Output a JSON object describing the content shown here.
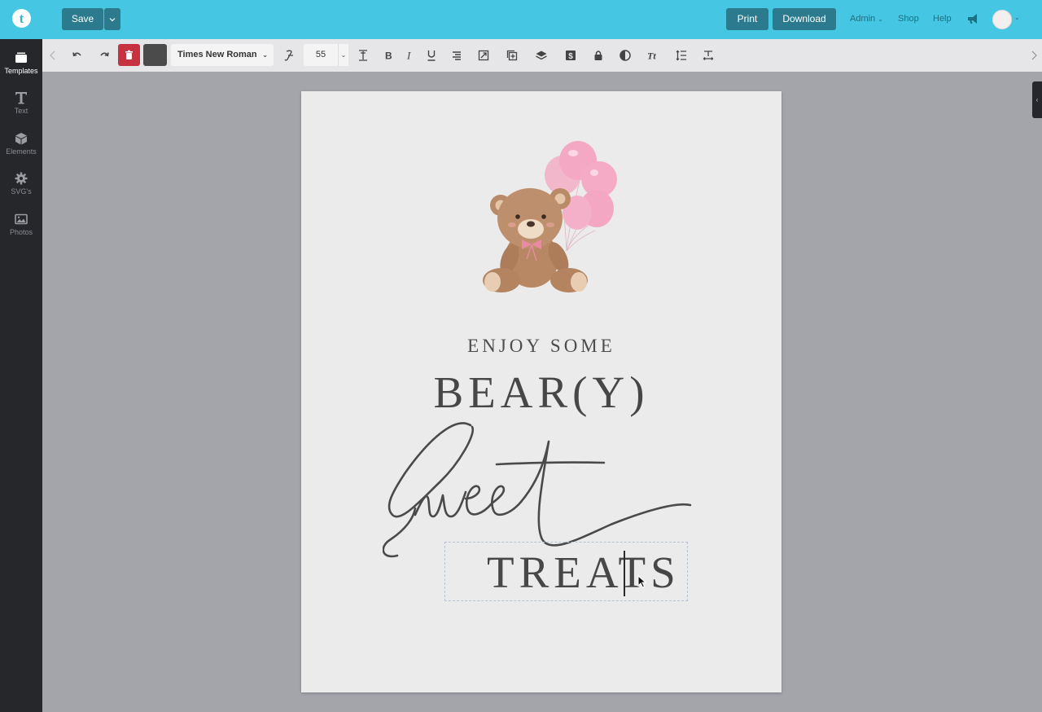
{
  "app": {
    "logo_letter": "t",
    "accent_color": "#45c6e3",
    "button_color": "#2c7a8d"
  },
  "header": {
    "save_label": "Save",
    "print_label": "Print",
    "download_label": "Download",
    "admin_label": "Admin",
    "shop_label": "Shop",
    "help_label": "Help",
    "icons": [
      "megaphone-icon",
      "avatar"
    ]
  },
  "sidebar": {
    "items": [
      {
        "label": "Templates",
        "icon": "templates-icon",
        "active": true
      },
      {
        "label": "Text",
        "icon": "text-icon",
        "active": false
      },
      {
        "label": "Elements",
        "icon": "cube-icon",
        "active": false
      },
      {
        "label": "SVG's",
        "icon": "gear-icon",
        "active": false
      },
      {
        "label": "Photos",
        "icon": "image-icon",
        "active": false
      }
    ]
  },
  "toolbar": {
    "font_family": "Times New Roman",
    "font_size": "55",
    "text_color": "#4b4b4b",
    "icons": [
      "undo-icon",
      "redo-icon",
      "trash-icon",
      "font-style-icon",
      "text-height-icon",
      "bold-icon",
      "italic-icon",
      "underline-icon",
      "align-icon",
      "resize-icon",
      "duplicate-icon",
      "layers-icon",
      "dollar-icon",
      "lock-icon",
      "opacity-icon",
      "text-case-icon",
      "line-height-icon",
      "letter-spacing-icon"
    ]
  },
  "canvas": {
    "line1": "ENJOY SOME",
    "line2": "BEAR(Y)",
    "script_word": "Sweet",
    "line3": "TREATS"
  }
}
